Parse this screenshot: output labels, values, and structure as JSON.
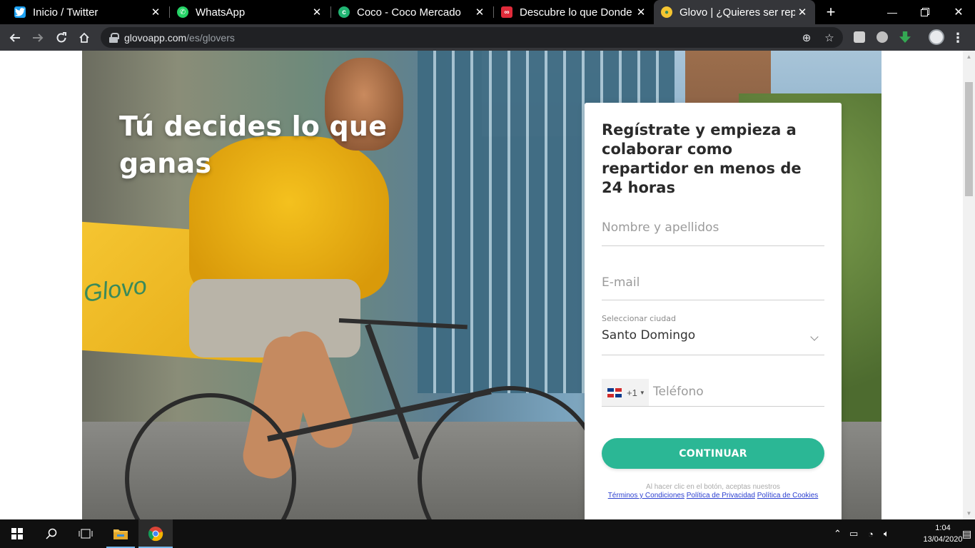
{
  "browser": {
    "tabs": [
      {
        "title": "Inicio / Twitter",
        "favicon_color": "#1da1f2",
        "favicon": "twitter-icon"
      },
      {
        "title": "WhatsApp",
        "favicon_color": "#25d366",
        "favicon": "whatsapp-icon"
      },
      {
        "title": "Coco - Coco Mercado",
        "favicon_color": "#21b573",
        "favicon": "coco-icon"
      },
      {
        "title": "Descubre lo que Donde I",
        "favicon_color": "#e02b3a",
        "favicon": "link-icon"
      },
      {
        "title": "Glovo | ¿Quieres ser repa",
        "favicon_color": "#f5c531",
        "favicon": "glovo-pin-icon"
      }
    ],
    "url": {
      "host": "glovoapp.com",
      "path": "/es/glovers"
    }
  },
  "hero": {
    "heading": "Tú decides lo que ganas",
    "box_logo": "Glovo"
  },
  "form": {
    "title": "Regístrate y empieza a colaborar como repartidor en menos de 24 horas",
    "name_placeholder": "Nombre y apellidos",
    "email_placeholder": "E-mail",
    "city_label": "Seleccionar ciudad",
    "city_value": "Santo Domingo",
    "phone_code": "+1",
    "phone_placeholder": "Teléfono",
    "submit_label": "CONTINUAR",
    "legal_text": "Al hacer clic en el botón, aceptas nuestros",
    "terms_link": "Términos y Condiciones",
    "privacy_link": "Política de Privacidad",
    "cookies_link": "Política de Cookies"
  },
  "taskbar": {
    "time": "1:04",
    "date": "13/04/2020"
  },
  "colors": {
    "accent": "#2bb795",
    "brand_yellow": "#f5c531"
  }
}
